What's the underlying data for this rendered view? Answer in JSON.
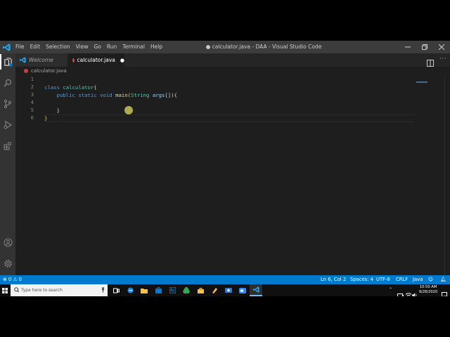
{
  "titlebar": {
    "menus": [
      "File",
      "Edit",
      "Selection",
      "View",
      "Go",
      "Run",
      "Terminal",
      "Help"
    ],
    "window_title": "● calculator.java - DAA - Visual Studio Code"
  },
  "tabs": [
    {
      "label": "Welcome"
    },
    {
      "label": "calculator.java",
      "dirty_marker": "●"
    }
  ],
  "breadcrumb": "calculator.java",
  "editor": {
    "line_numbers": [
      "1",
      "2",
      "3",
      "4",
      "5",
      "6"
    ],
    "code": {
      "l2_class": "class ",
      "l2_name": "calculator",
      "l2_brace": "{",
      "l3_indent": "    ",
      "l3_public": "public ",
      "l3_static": "static ",
      "l3_void": "void ",
      "l3_main": "main",
      "l3_open": "(",
      "l3_type": "String ",
      "l3_arg": "args",
      "l3_rest": "[]){",
      "l5": "    }",
      "l6": "}"
    }
  },
  "statusbar": {
    "errors": "0",
    "warnings": "0",
    "position": "Ln 6, Col 2",
    "spaces": "Spaces: 4",
    "encoding": "UTF-8",
    "eol": "CRLF",
    "language": "Java"
  },
  "taskbar": {
    "search_placeholder": "Type here to search",
    "time": "10:50 AM",
    "date": "9/28/2020"
  },
  "colors": {
    "statusbar": "#007acc",
    "titlebar": "#3c3c3c",
    "editor_bg": "#1e1e1e",
    "keyword": "#569cd6",
    "function": "#dcdcaa",
    "type": "#4ec9b0"
  }
}
